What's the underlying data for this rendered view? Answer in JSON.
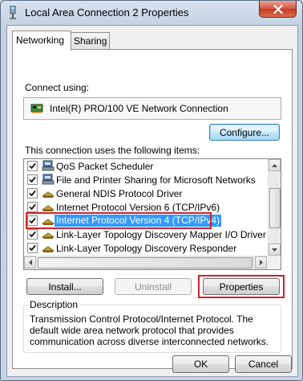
{
  "window": {
    "title": "Local Area Connection 2 Properties",
    "close_label": "close"
  },
  "tabs": [
    {
      "label": "Networking",
      "active": true
    },
    {
      "label": "Sharing",
      "active": false
    }
  ],
  "connect_using": {
    "label": "Connect using:",
    "adapter_name": "Intel(R) PRO/100 VE Network Connection",
    "configure_label": "Configure..."
  },
  "items_section": {
    "label": "This connection uses the following items:",
    "items": [
      {
        "label": "QoS Packet Scheduler",
        "checked": true,
        "icon": "network-service-icon",
        "selected": false
      },
      {
        "label": "File and Printer Sharing for Microsoft Networks",
        "checked": true,
        "icon": "network-service-icon",
        "selected": false
      },
      {
        "label": "General NDIS Protocol Driver",
        "checked": true,
        "icon": "protocol-icon",
        "selected": false
      },
      {
        "label": "Internet Protocol Version 6 (TCP/IPv6)",
        "checked": true,
        "icon": "protocol-icon",
        "selected": false
      },
      {
        "label": "Internet Protocol Version 4 (TCP/IPv4)",
        "checked": true,
        "icon": "protocol-icon",
        "selected": true
      },
      {
        "label": "Link-Layer Topology Discovery Mapper I/O Driver",
        "checked": true,
        "icon": "protocol-icon",
        "selected": false
      },
      {
        "label": "Link-Layer Topology Discovery Responder",
        "checked": true,
        "icon": "protocol-icon",
        "selected": false
      }
    ]
  },
  "buttons": {
    "install": "Install...",
    "uninstall": "Uninstall",
    "properties": "Properties",
    "ok": "OK",
    "cancel": "Cancel"
  },
  "description": {
    "legend": "Description",
    "text": "Transmission Control Protocol/Internet Protocol. The default wide area network protocol that provides communication across diverse interconnected networks."
  },
  "colors": {
    "highlight_outline": "#d0212b",
    "selection": "#3399ff"
  }
}
